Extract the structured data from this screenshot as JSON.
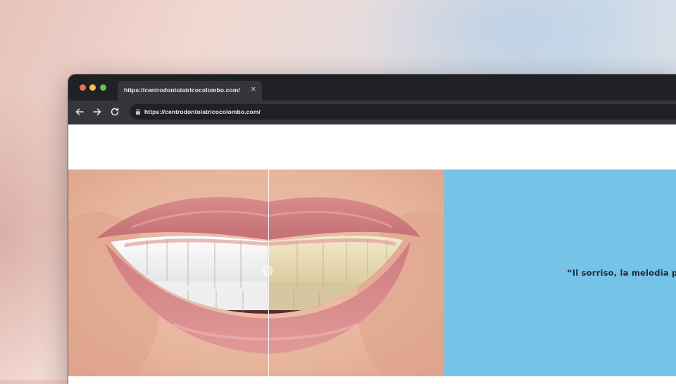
{
  "browser": {
    "tab_title": "https://centrodontoiatricocolombo.com/",
    "tab_close_icon": "close-icon",
    "url": "https://centrodontoiatricocolombo.com/",
    "nav_icons": [
      "arrow-left-icon",
      "arrow-right-icon",
      "reload-icon",
      "lock-icon"
    ]
  },
  "hero": {
    "image_description_icon": "before-after-teeth-whitening-photo",
    "comparison_split_fraction": 0.53,
    "quote": "“Il sorriso, la melodia più d",
    "colors": {
      "quote_panel": "#76c3e8",
      "browser_chrome": "#202124",
      "toolbar": "#35363a"
    }
  }
}
